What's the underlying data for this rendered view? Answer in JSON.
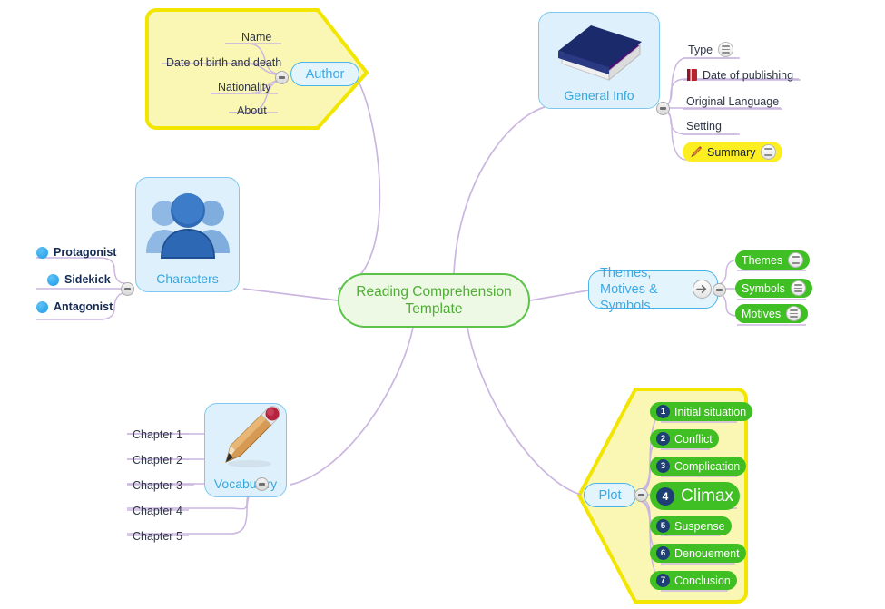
{
  "map": {
    "central_node": {
      "label": "Reading Comprehension Template",
      "fill": "#edf9e4",
      "border": "#5cc24a",
      "text_color": "#4fae34"
    },
    "branches": {
      "author": {
        "label": "Author",
        "boundary_color": "#f2e600",
        "boundary_fill": "#faf6b4",
        "children": [
          {
            "label": "Name"
          },
          {
            "label": "Date of birth and death"
          },
          {
            "label": "Nationality"
          },
          {
            "label": "About"
          }
        ],
        "toggle": "collapse-minus"
      },
      "general_info": {
        "label": "General Info",
        "icon": "blue-book-icon",
        "children": [
          {
            "label": "Type",
            "note": "note-icon"
          },
          {
            "label": "Date of publishing",
            "icon": "red-book-icon"
          },
          {
            "label": "Original Language"
          },
          {
            "label": "Setting"
          },
          {
            "label": "Summary",
            "icon": "pencil-icon",
            "note": "note-icon",
            "highlight": "#fcee21"
          }
        ],
        "toggle": "collapse-minus"
      },
      "characters": {
        "label": "Characters",
        "icon": "people-icon",
        "children": [
          {
            "label": "Protagonist",
            "bullet": "#1e9ae8"
          },
          {
            "label": "Sidekick",
            "bullet": "#1e9ae8"
          },
          {
            "label": "Antagonist",
            "bullet": "#1e9ae8"
          }
        ],
        "toggle": "collapse-minus"
      },
      "themes": {
        "label": "Themes, Motives & Symbols",
        "link_icon": "arrow-right-icon",
        "children": [
          {
            "label": "Themes",
            "note": "note-icon"
          },
          {
            "label": "Symbols",
            "note": "note-icon"
          },
          {
            "label": "Motives",
            "note": "note-icon"
          }
        ],
        "toggle": "collapse-minus"
      },
      "plot": {
        "label": "Plot",
        "boundary_color": "#f2e600",
        "boundary_fill": "#faf6b4",
        "children": [
          {
            "num": "1",
            "label": "Initial situation"
          },
          {
            "num": "2",
            "label": "Conflict"
          },
          {
            "num": "3",
            "label": "Complication"
          },
          {
            "num": "4",
            "label": "Climax",
            "emphasis": true
          },
          {
            "num": "5",
            "label": "Suspense"
          },
          {
            "num": "6",
            "label": "Denouement"
          },
          {
            "num": "7",
            "label": "Conclusion"
          }
        ],
        "toggle": "collapse-minus"
      },
      "vocabulary": {
        "label": "Vocabulary",
        "icon": "pencil-icon",
        "children": [
          {
            "label": "Chapter 1"
          },
          {
            "label": "Chapter 2"
          },
          {
            "label": "Chapter 3"
          },
          {
            "label": "Chapter 4"
          },
          {
            "label": "Chapter 5"
          }
        ],
        "toggle": "collapse-minus"
      }
    },
    "colors": {
      "branch_line": "#cbb6e0",
      "green_pill": "#3fbf23",
      "blue_node_fill": "#ddf0fb",
      "blue_node_border": "#7ec8f0",
      "blue_text": "#35a8e0",
      "num_badge": "#1d3f73"
    }
  }
}
